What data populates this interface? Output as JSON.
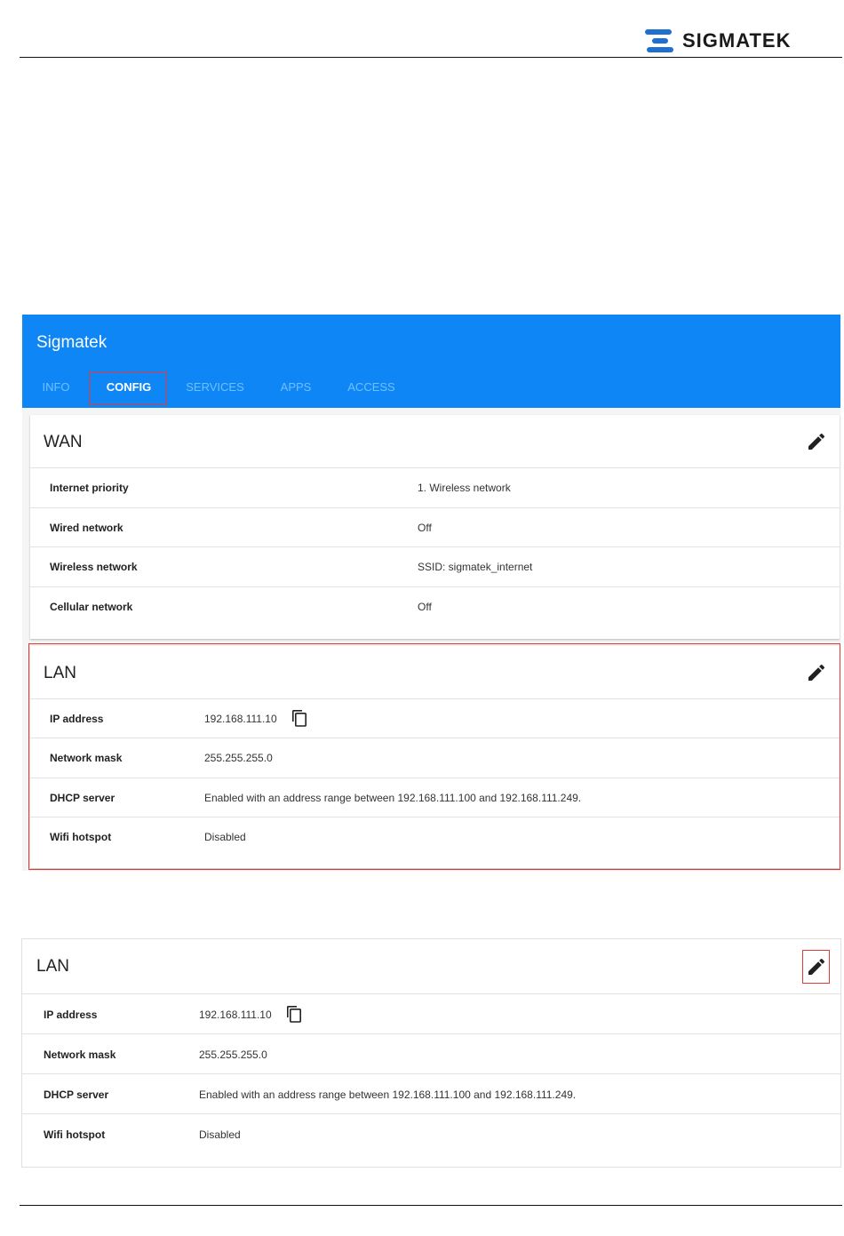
{
  "doc": {
    "brand": "SIGMATEK"
  },
  "app": {
    "title": "Sigmatek",
    "tabs": [
      {
        "label": "INFO"
      },
      {
        "label": "CONFIG"
      },
      {
        "label": "SERVICES"
      },
      {
        "label": "APPS"
      },
      {
        "label": "ACCESS"
      }
    ],
    "active_tab": "CONFIG",
    "accent_color": "#0f86f5",
    "highlight_color": "#e53935"
  },
  "wan": {
    "title": "WAN",
    "rows": [
      {
        "label": "Internet priority",
        "value": "1. Wireless network"
      },
      {
        "label": "Wired network",
        "value": "Off"
      },
      {
        "label": "Wireless network",
        "value": "SSID: sigmatek_internet"
      },
      {
        "label": "Cellular network",
        "value": "Off"
      }
    ]
  },
  "lan": {
    "title": "LAN",
    "rows": [
      {
        "label": "IP address",
        "value": "192.168.111.10"
      },
      {
        "label": "Network mask",
        "value": "255.255.255.0"
      },
      {
        "label": "DHCP server",
        "value": "Enabled with an address range between 192.168.111.100 and 192.168.111.249."
      },
      {
        "label": "Wifi hotspot",
        "value": "Disabled"
      }
    ]
  },
  "lan_detail": {
    "title": "LAN",
    "rows": [
      {
        "label": "IP address",
        "value": "192.168.111.10"
      },
      {
        "label": "Network mask",
        "value": "255.255.255.0"
      },
      {
        "label": "DHCP server",
        "value": "Enabled with an address range between 192.168.111.100 and 192.168.111.249."
      },
      {
        "label": "Wifi hotspot",
        "value": "Disabled"
      }
    ]
  },
  "icons": {
    "edit": "pencil-icon",
    "copy": "copy-icon"
  }
}
